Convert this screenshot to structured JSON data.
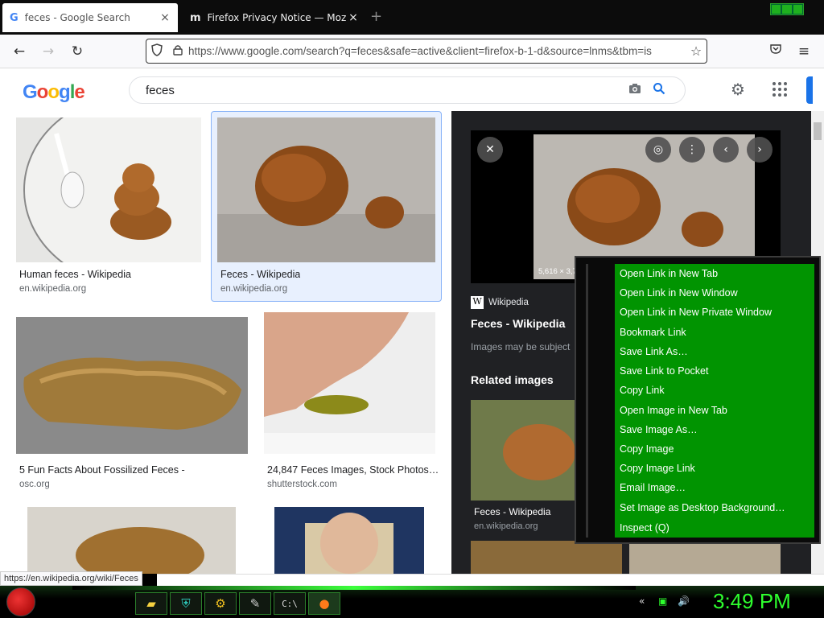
{
  "tabs": [
    {
      "icon": "G",
      "title": "feces - Google Search",
      "close": "×"
    },
    {
      "icon": "m",
      "title": "Firefox Privacy Notice — Mozilla",
      "close": "×"
    }
  ],
  "new_tab": "+",
  "nav": {
    "url": "https://www.google.com/search?q=feces&safe=active&client=firefox-b-1-d&source=lnms&tbm=is",
    "back": "←",
    "forward": "→",
    "reload": "↻",
    "menu": "≡"
  },
  "google": {
    "logo": "Google",
    "query": "feces"
  },
  "results": [
    {
      "caption": "Human feces - Wikipedia",
      "source": "en.wikipedia.org"
    },
    {
      "caption": "Feces - Wikipedia",
      "source": "en.wikipedia.org"
    },
    {
      "caption": "5 Fun Facts About Fossilized Feces -",
      "source": "osc.org"
    },
    {
      "caption": "24,847 Feces Images, Stock Photos…",
      "source": "shutterstock.com"
    }
  ],
  "panel": {
    "dimensions": "5,616 × 3,744",
    "site": "Wikipedia",
    "title": "Feces - Wikipedia",
    "subtitle": "Images may be subject",
    "related": "Related images",
    "related_caption": "Feces - Wikipedia",
    "related_source": "en.wikipedia.org"
  },
  "context_menu": [
    "Open Link in New Tab",
    "Open Link in New Window",
    "Open Link in New Private Window",
    "Bookmark Link",
    "Save Link As…",
    "Save Link to Pocket",
    "Copy Link",
    "Open Image in New Tab",
    "Save Image As…",
    "Copy Image",
    "Copy Image Link",
    "Email Image…",
    "Set Image as Desktop Background…",
    "Inspect (Q)"
  ],
  "status_link": "https://en.wikipedia.org/wiki/Feces",
  "clock": "3:49 PM",
  "colors": {
    "accent_green": "#019401",
    "google_blue": "#1a73e8",
    "clock_green": "#2eff2e"
  }
}
